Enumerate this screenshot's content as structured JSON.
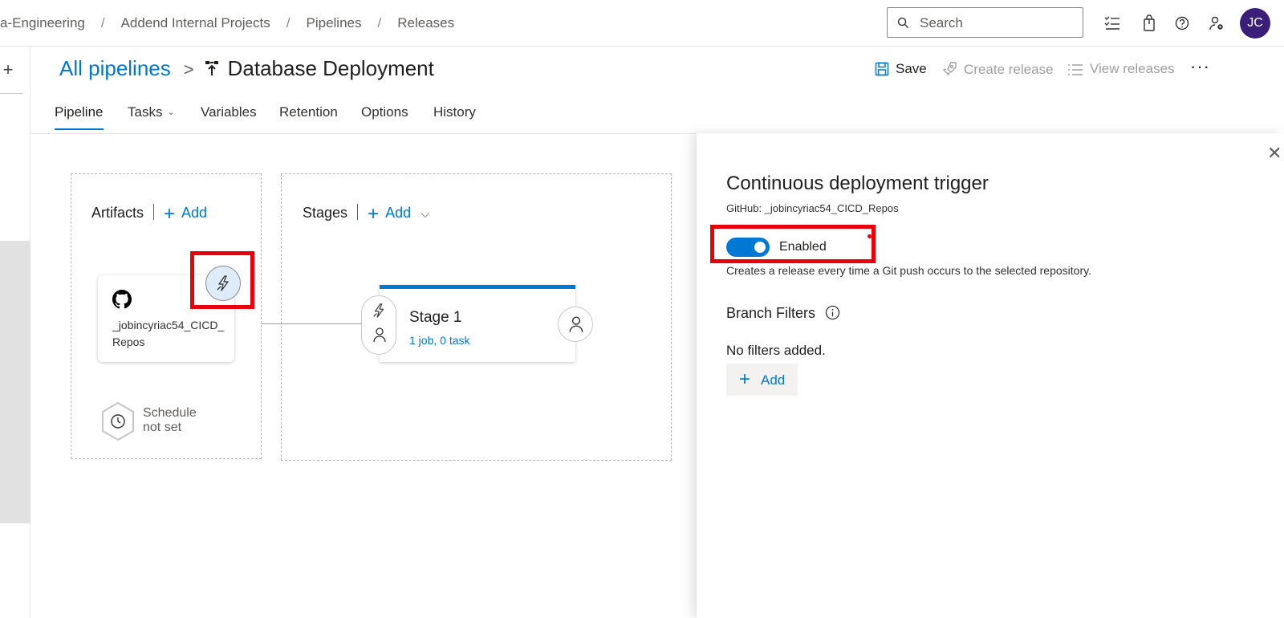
{
  "breadcrumb": {
    "items": [
      "a-Engineering",
      "Addend Internal Projects",
      "Pipelines",
      "Releases"
    ],
    "separator": "/"
  },
  "search": {
    "placeholder": "Search"
  },
  "topbar": {
    "icons": [
      "task-list-icon",
      "shopping-bag-icon",
      "help-icon",
      "user-settings-icon"
    ],
    "avatar_initials": "JC",
    "avatar_color": "#3b1e7a"
  },
  "header": {
    "all_pipelines": "All pipelines",
    "chevron": ">",
    "pipeline_name": "Database Deployment",
    "save_label": "Save",
    "create_release_label": "Create release",
    "view_releases_label": "View releases",
    "more_label": "···"
  },
  "tabs": [
    {
      "label": "Pipeline",
      "active": true
    },
    {
      "label": "Tasks",
      "active": false,
      "has_dropdown": true
    },
    {
      "label": "Variables",
      "active": false
    },
    {
      "label": "Retention",
      "active": false
    },
    {
      "label": "Options",
      "active": false
    },
    {
      "label": "History",
      "active": false
    }
  ],
  "artifacts": {
    "heading": "Artifacts",
    "add_label": "Add",
    "artifact_name": "_jobincyriac54_CICD_Repos",
    "schedule_line1": "Schedule",
    "schedule_line2": "not set"
  },
  "stages": {
    "heading": "Stages",
    "add_label": "Add",
    "stage_name": "Stage 1",
    "stage_summary": "1 job, 0 task"
  },
  "panel": {
    "title": "Continuous deployment trigger",
    "subtitle": "GitHub: _jobincyriac54_CICD_Repos",
    "toggle_label": "Enabled",
    "toggle_on": true,
    "description": "Creates a release every time a Git push occurs to the selected repository.",
    "branch_filters_label": "Branch Filters",
    "no_filters": "No filters added.",
    "add_label": "Add",
    "close_label": "✕"
  },
  "colors": {
    "accent": "#0078d4",
    "highlight": "#e8000b",
    "disabled_text": "#a19f9d"
  }
}
